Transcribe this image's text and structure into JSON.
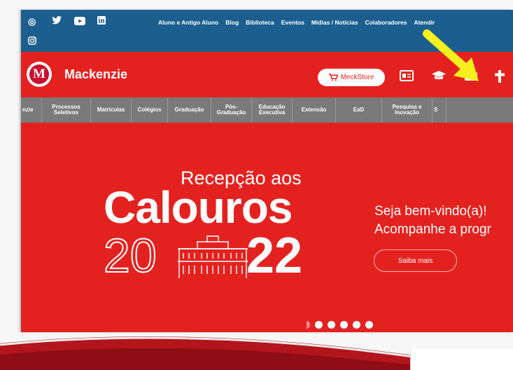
{
  "colors": {
    "brand_red": "#e32220",
    "topbar_blue": "#1c5f8f",
    "nav_gray": "#7a7a7a",
    "arrow_yellow": "#f6ef1d"
  },
  "social_icons": [
    "instagram-icon",
    "twitter-icon",
    "youtube-icon",
    "linkedin-icon",
    "instagram-icon"
  ],
  "top_links": [
    "Aluno e Antigo Aluno",
    "Blog",
    "Biblioteca",
    "Eventos",
    "Mídias / Notícias",
    "Colaboradores",
    "Atendir"
  ],
  "header": {
    "logo_letter": "M",
    "brand": "Mackenzie",
    "meckstore_label": "MeckStore",
    "icons": [
      "id-card-icon",
      "graduation-cap-icon",
      "mail-icon",
      "cross-icon"
    ]
  },
  "nav": [
    "nzie",
    "Processos Seletivos",
    "Matrículas",
    "Colégios",
    "Graduação",
    "Pós-Graduação",
    "Educação Executiva",
    "Extensão",
    "EaD",
    "Pesquisa e Inovação",
    "S"
  ],
  "hero": {
    "line1": "Recepção aos",
    "line2": "Calouros",
    "year_left": "20",
    "year_right": "22",
    "welcome_line1": "Seja bem-vindo(a)!",
    "welcome_line2": "Acompanhe a progr",
    "cta_label": "Saiba mais",
    "carousel_total": 6,
    "carousel_active": 1
  }
}
